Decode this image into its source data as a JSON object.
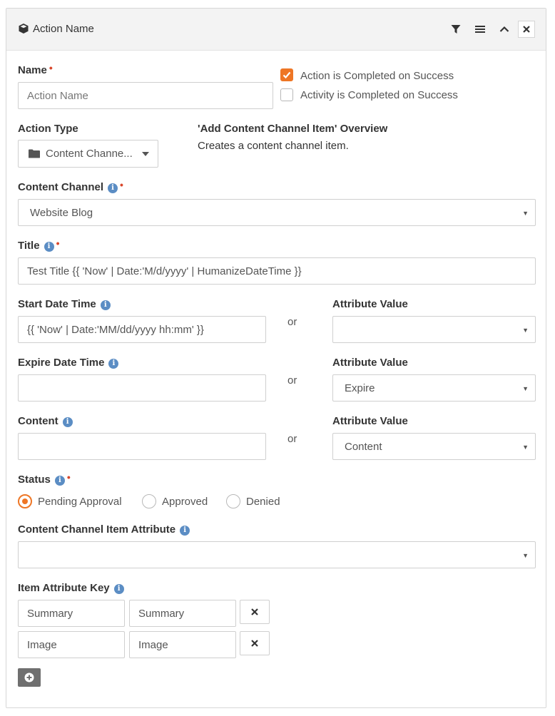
{
  "header": {
    "title": "Action Name",
    "icons": [
      "cube-icon",
      "filter-icon",
      "menu-icon",
      "chevron-up-icon",
      "close-icon"
    ]
  },
  "name": {
    "label": "Name",
    "placeholder": "Action Name",
    "value": ""
  },
  "checks": {
    "action_completed": {
      "label": "Action is Completed on Success",
      "checked": true
    },
    "activity_completed": {
      "label": "Activity is Completed on Success",
      "checked": false
    }
  },
  "action_type": {
    "label": "Action Type",
    "value": "Content Channe..."
  },
  "overview": {
    "title": "'Add Content Channel Item' Overview",
    "text": "Creates a content channel item."
  },
  "content_channel": {
    "label": "Content Channel",
    "value": "Website Blog"
  },
  "title_field": {
    "label": "Title",
    "value": "Test Title {{ 'Now' | Date:'M/d/yyyy' | HumanizeDateTime }}"
  },
  "start_date": {
    "label": "Start Date Time",
    "value": "{{ 'Now' | Date:'MM/dd/yyyy hh:mm' }}",
    "or": "or",
    "attr_label": "Attribute Value",
    "attr_value": ""
  },
  "expire_date": {
    "label": "Expire Date Time",
    "value": "",
    "or": "or",
    "attr_label": "Attribute Value",
    "attr_value": "Expire"
  },
  "content": {
    "label": "Content",
    "value": "",
    "or": "or",
    "attr_label": "Attribute Value",
    "attr_value": "Content"
  },
  "status": {
    "label": "Status",
    "options": [
      {
        "label": "Pending Approval",
        "selected": true
      },
      {
        "label": "Approved",
        "selected": false
      },
      {
        "label": "Denied",
        "selected": false
      }
    ]
  },
  "item_attribute": {
    "label": "Content Channel Item Attribute",
    "value": ""
  },
  "item_attribute_key": {
    "label": "Item Attribute Key",
    "rows": [
      {
        "key": "Summary",
        "value": "Summary"
      },
      {
        "key": "Image",
        "value": "Image"
      }
    ]
  },
  "colors": {
    "accent": "#ee7625",
    "info": "#5b8dc4",
    "required": "#d9472b"
  }
}
